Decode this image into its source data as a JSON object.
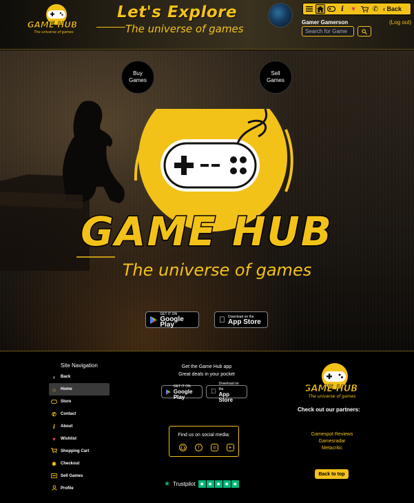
{
  "header": {
    "title": "Let's Explore",
    "subtitle": "The universe of games",
    "user_name": "Gamer Gamerson",
    "logout_label": "(Log out)",
    "search_placeholder": "Search for Game",
    "toolbar": {
      "icons": [
        "menu-icon",
        "home-icon",
        "gamepad-icon",
        "info-icon",
        "heart-icon",
        "cart-icon",
        "phone-icon"
      ],
      "back_label": "Back"
    }
  },
  "logo": {
    "wordmark": "GAME HUB",
    "tagline": "The universe of games"
  },
  "hero": {
    "buy_label": "Buy Games",
    "sell_label": "Sell Games",
    "google_play": {
      "small": "GET IT ON",
      "big": "Google Play"
    },
    "app_store": {
      "small": "Download on the",
      "big": "App Store"
    }
  },
  "footer": {
    "nav_title": "Site Navigation",
    "nav_items": [
      {
        "label": "Back",
        "icon": "chevron-left-icon"
      },
      {
        "label": "Home",
        "icon": "home-icon",
        "active": true
      },
      {
        "label": "Store",
        "icon": "gamepad-icon"
      },
      {
        "label": "Contact",
        "icon": "phone-icon"
      },
      {
        "label": "About",
        "icon": "info-icon"
      },
      {
        "label": "Wishlist",
        "icon": "heart-icon"
      },
      {
        "label": "Shopping Cart",
        "icon": "cart-icon"
      },
      {
        "label": "Checkout",
        "icon": "badge-icon"
      },
      {
        "label": "Sell Games",
        "icon": "sell-icon"
      },
      {
        "label": "Profile",
        "icon": "user-icon"
      }
    ],
    "get_app_line1": "Get the Game Hub app",
    "get_app_line2": "Great deals in your pocket",
    "social_label": "Find us on social media:",
    "social_icons": [
      "snapchat-icon",
      "facebook-icon",
      "instagram-icon",
      "youtube-icon"
    ],
    "trustpilot_label": "Trustpilot",
    "partners_title": "Check out our partners:",
    "partners": [
      "Gamespot Reviews",
      "Gamesradar",
      "Metacritic"
    ],
    "back_to_top": "Back to top"
  },
  "colors": {
    "accent": "#f3c219",
    "background": "#000000",
    "trustpilot": "#00b67a"
  }
}
